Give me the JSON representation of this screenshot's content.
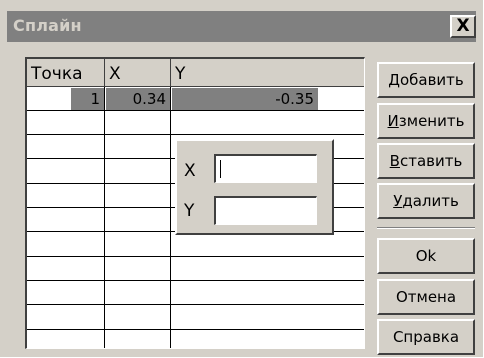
{
  "window": {
    "title": "Сплайн",
    "close_label": "X"
  },
  "table": {
    "columns": [
      "Точка",
      "X",
      "Y"
    ],
    "rows": [
      {
        "point": "1",
        "x": "0.34",
        "y": "-0.35"
      }
    ]
  },
  "popup": {
    "x_label": "X",
    "y_label": "Y",
    "x_value": "",
    "y_value": ""
  },
  "buttons": {
    "add": {
      "hot": "Д",
      "rest": "обавить"
    },
    "edit": {
      "hot": "И",
      "rest": "зменить"
    },
    "insert": {
      "hot": "В",
      "rest": "ставить"
    },
    "delete": {
      "hot": "У",
      "rest": "далить"
    },
    "ok": "Ok",
    "cancel": "Отмена",
    "help": "Справка"
  }
}
